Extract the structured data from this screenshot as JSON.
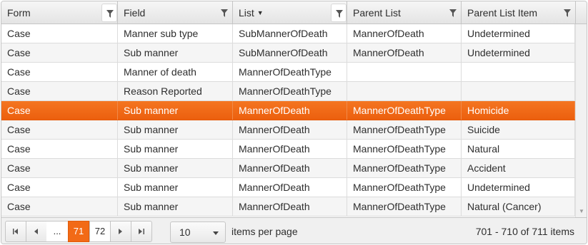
{
  "columns": [
    {
      "label": "Form",
      "sorted": false,
      "filter_active": true
    },
    {
      "label": "Field",
      "sorted": false,
      "filter_active": false
    },
    {
      "label": "List",
      "sorted": true,
      "sort_indicator": "▼",
      "filter_active": true
    },
    {
      "label": "Parent List",
      "sorted": false,
      "filter_active": false
    },
    {
      "label": "Parent List Item",
      "sorted": false,
      "filter_active": false
    }
  ],
  "rows": [
    [
      "Case",
      "Manner sub type",
      "SubMannerOfDeath",
      "MannerOfDeath",
      "Undetermined"
    ],
    [
      "Case",
      "Sub manner",
      "SubMannerOfDeath",
      "MannerOfDeath",
      "Undetermined"
    ],
    [
      "Case",
      "Manner of death",
      "MannerOfDeathType",
      "",
      ""
    ],
    [
      "Case",
      "Reason Reported",
      "MannerOfDeathType",
      "",
      ""
    ],
    [
      "Case",
      "Sub manner",
      "MannerOfDeath",
      "MannerOfDeathType",
      "Homicide"
    ],
    [
      "Case",
      "Sub manner",
      "MannerOfDeath",
      "MannerOfDeathType",
      "Suicide"
    ],
    [
      "Case",
      "Sub manner",
      "MannerOfDeath",
      "MannerOfDeathType",
      "Natural"
    ],
    [
      "Case",
      "Sub manner",
      "MannerOfDeath",
      "MannerOfDeathType",
      "Accident"
    ],
    [
      "Case",
      "Sub manner",
      "MannerOfDeath",
      "MannerOfDeathType",
      "Undetermined"
    ],
    [
      "Case",
      "Sub manner",
      "MannerOfDeath",
      "MannerOfDeathType",
      "Natural (Cancer)"
    ]
  ],
  "selected_row": 4,
  "colors": {
    "selected": "#f26a16",
    "header": "#e8e8e8"
  },
  "pager": {
    "first_icon": "first-page-icon",
    "prev_icon": "previous-page-icon",
    "ellipsis": "...",
    "pages": [
      "71",
      "72"
    ],
    "current_page": "71",
    "next_icon": "next-page-icon",
    "last_icon": "last-page-icon",
    "page_size": "10",
    "items_per_page_label": "items per page",
    "info": "701 - 710 of 711 items"
  }
}
